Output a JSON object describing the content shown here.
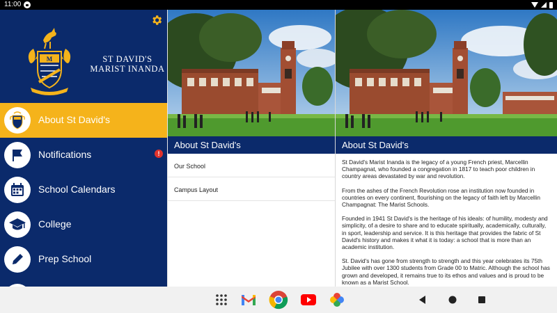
{
  "status_bar": {
    "time": "11:00"
  },
  "sidebar": {
    "school_name_line1": "ST DAVID'S",
    "school_name_line2": "MARIST INANDA",
    "items": [
      {
        "label": "About St David's",
        "icon": "crest-icon",
        "active": true
      },
      {
        "label": "Notifications",
        "icon": "flag-icon",
        "badge": "!"
      },
      {
        "label": "School Calendars",
        "icon": "calendar-icon"
      },
      {
        "label": "College",
        "icon": "graduation-cap-icon"
      },
      {
        "label": "Prep School",
        "icon": "pencil-icon"
      }
    ]
  },
  "list_panel": {
    "title": "About St David's",
    "rows": [
      {
        "label": "Our School"
      },
      {
        "label": "Campus Layout"
      }
    ]
  },
  "detail_panel": {
    "title": "About St David's",
    "paragraphs": [
      "St David's Marist Inanda is the legacy of a young French priest, Marcellin Champagnat, who founded a congregation in 1817 to teach poor children in country areas devastated by war and revolution.",
      "From the ashes of the French Revolution rose an institution now founded in countries on every continent, flourishing on the legacy of faith left by Marcellin Champagnat: The Marist Schools.",
      "Founded in 1941 St David's is the heritage of his ideals: of humility, modesty and simplicity, of a desire to share and to educate spiritually, academically, culturally, in sport, leadership and service. It is this heritage that provides the fabric of St David's history and makes it what it is today: a school that is more than an academic institution.",
      "St. David's has gone from strength to strength and this year celebrates its 75th Jubilee with over 1300 students from Grade 00 to Matric. Although the school has grown and developed, it remains true to its ethos and values and is proud to be known as a Marist School."
    ]
  },
  "nav_bar": {
    "apps": [
      "app-drawer-icon",
      "gmail-icon",
      "chrome-icon",
      "youtube-icon",
      "photos-icon"
    ],
    "buttons": [
      "back-button",
      "home-button",
      "recents-button"
    ]
  },
  "colors": {
    "navy": "#0b2a6b",
    "gold": "#f5b31b",
    "badge_red": "#e0322b"
  }
}
